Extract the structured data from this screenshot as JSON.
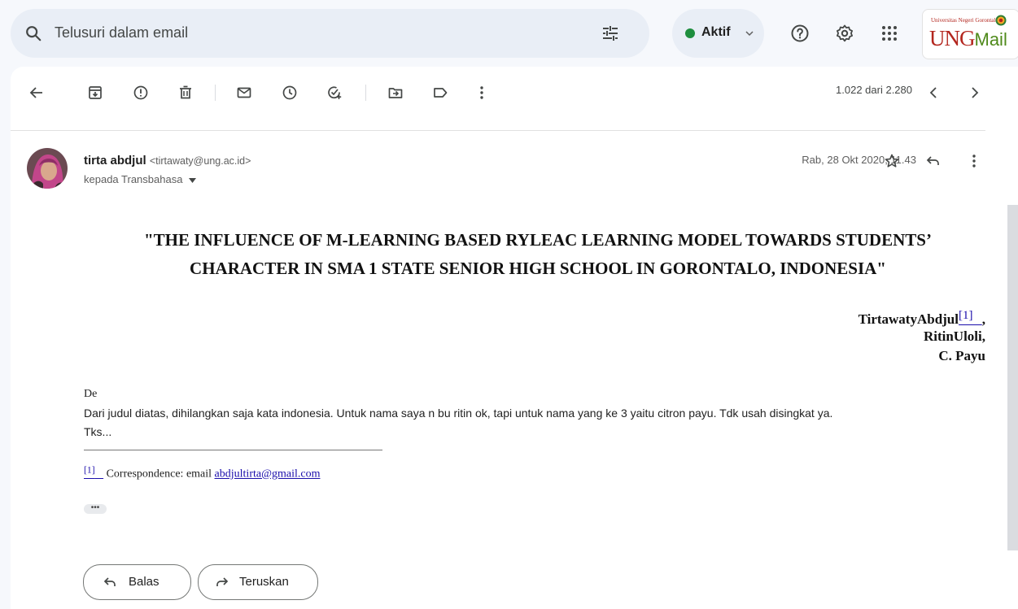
{
  "search": {
    "placeholder": "Telusuri dalam email"
  },
  "status": {
    "label": "Aktif"
  },
  "logo": {
    "top_text": "Universitas Negeri Gorontalo",
    "word_main": "UNG",
    "word_suffix": "Mail"
  },
  "toolbar": {
    "counter": "1.022 dari 2.280"
  },
  "email": {
    "sender_name": "tirta abdjul",
    "sender_email": "<tirtawaty@ung.ac.id>",
    "recipient": "kepada Transbahasa",
    "date": "Rab, 28 Okt 2020, 11.43",
    "subject_line1": "\"THE INFLUENCE OF M-LEARNING BASED RYLEAC LEARNING MODEL TOWARDS STUDENTS’",
    "subject_line2": "CHARACTER IN SMA 1 STATE SENIOR HIGH SCHOOL IN GORONTALO, INDONESIA\"",
    "author1": "TirtawatyAbdjul",
    "footnote_ref": "[1]",
    "author1_suffix": ",",
    "author2": "RitinUloli,",
    "author3": "C. Payu",
    "greeting": "De",
    "message_line1": "Dari judul diatas, dihilangkan saja kata indonesia. Untuk nama saya n bu ritin ok, tapi untuk nama yang ke 3 yaitu citron payu. Tdk usah disingkat ya.",
    "message_line2": "Tks...",
    "footnote_text": " Correspondence: email ",
    "footnote_email": "abdjultirta@gmail.com",
    "ellipsis": "•••"
  },
  "actions": {
    "reply_label": "Balas",
    "forward_label": "Teruskan"
  },
  "colors": {
    "accent_status": "#1e8e3e",
    "link": "#1a0dab",
    "logo_red": "#b3261e",
    "logo_green": "#4f8a1b"
  }
}
